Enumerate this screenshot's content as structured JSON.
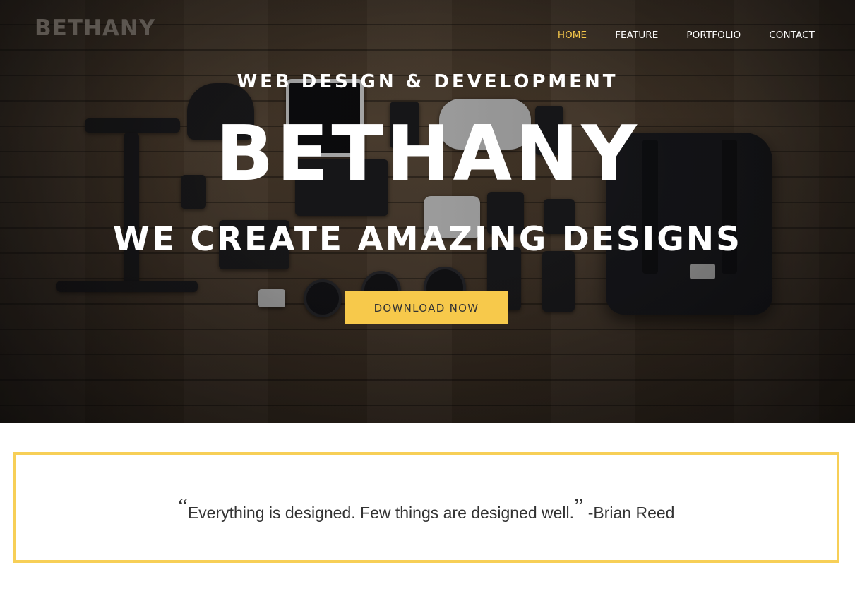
{
  "brand": {
    "logo": "BETHANY"
  },
  "nav": {
    "items": [
      {
        "label": "HOME",
        "active": true
      },
      {
        "label": "FEATURE",
        "active": false
      },
      {
        "label": "PORTFOLIO",
        "active": false
      },
      {
        "label": "CONTACT",
        "active": false
      }
    ]
  },
  "hero": {
    "kicker": "WEB DESIGN & DEVELOPMENT",
    "title": "BETHANY",
    "subtitle": "WE CREATE AMAZING DESIGNS",
    "cta_label": "DOWNLOAD NOW"
  },
  "quote": {
    "open_mark": "“",
    "text": "Everything is designed. Few things are designed well.",
    "close_mark": "”",
    "author": " -Brian Reed"
  },
  "colors": {
    "accent": "#f7c94b",
    "border_accent": "#f7cf57",
    "text_dark": "#333333",
    "nav_text": "#ffffff"
  }
}
